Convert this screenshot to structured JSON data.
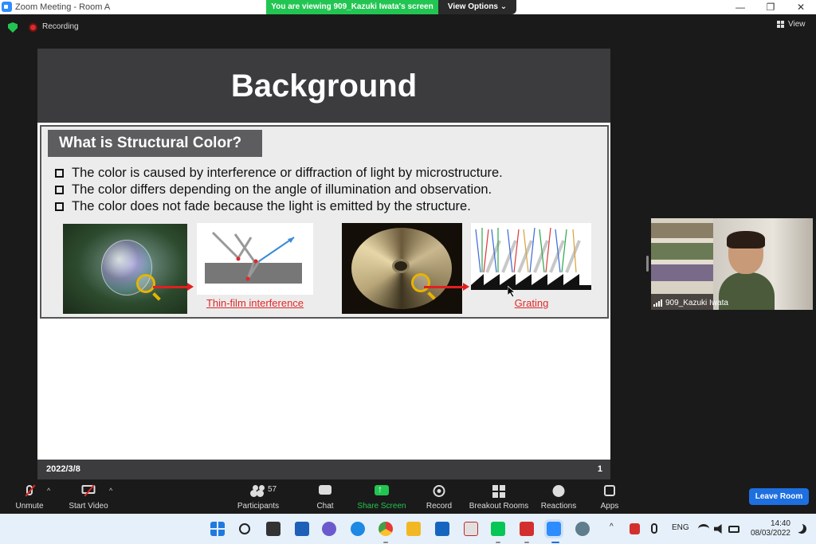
{
  "window": {
    "title": "Zoom Meeting - Room A",
    "minimize": "—",
    "restore": "❐",
    "close": "✕"
  },
  "share_banner": {
    "viewing_text": "You are viewing 909_Kazuki Iwata's screen",
    "view_options_label": "View Options ⌄"
  },
  "status": {
    "recording_label": "Recording",
    "view_label": "View"
  },
  "slide": {
    "title": "Background",
    "section_label": "What is Structural Color?",
    "bullets": [
      "The color is caused by interference or diffraction of light by microstructure.",
      "The color differs depending on the angle of illumination and observation.",
      "The color does not fade because the light is emitted by the structure."
    ],
    "caption_film": "Thin-film interference",
    "caption_grating": "Grating",
    "footer_date": "2022/3/8",
    "page_number": "1"
  },
  "participant": {
    "name": "909_Kazuki Iwata"
  },
  "toolbar": {
    "unmute_label": "Unmute",
    "start_video_label": "Start Video",
    "participants_label": "Participants",
    "participants_count": "57",
    "chat_label": "Chat",
    "share_screen_label": "Share Screen",
    "record_label": "Record",
    "breakout_label": "Breakout Rooms",
    "reactions_label": "Reactions",
    "apps_label": "Apps",
    "leave_label": "Leave Room",
    "caret": "^"
  },
  "taskbar": {
    "language": "ENG",
    "time": "14:40",
    "date": "08/03/2022",
    "tray_caret": "^"
  },
  "colors": {
    "accent_green": "#23c552",
    "leave_blue": "#1e6fe0",
    "record_red": "#e02828",
    "slide_header": "#3c3b3e"
  }
}
